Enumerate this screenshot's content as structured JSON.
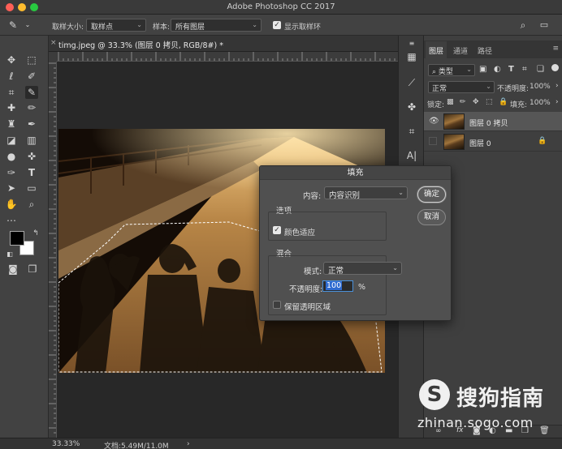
{
  "app": {
    "title": "Adobe Photoshop CC 2017"
  },
  "options": {
    "sample_size_label": "取样大小:",
    "sample_size_value": "取样点",
    "sample_label": "样本:",
    "sample_value": "所有图层",
    "show_ring_label": "显示取样环",
    "show_ring_checked": true
  },
  "document": {
    "tab_label": "timg.jpeg @ 33.3% (图层 0 拷贝, RGB/8#) *",
    "zoom": "33.33%",
    "doc_info": "文档:5.49M/11.0M"
  },
  "panel": {
    "tabs": [
      "图层",
      "通道",
      "路径"
    ],
    "filter_value": "类型",
    "blend_mode": "正常",
    "opacity_label": "不透明度:",
    "opacity_value": "100%",
    "lock_label": "锁定:",
    "fill_label": "填充:",
    "fill_value": "100%",
    "layers": [
      {
        "name": "图层 0 拷贝",
        "visible": true,
        "selected": true,
        "locked": false
      },
      {
        "name": "图层 0",
        "visible": false,
        "selected": false,
        "locked": true
      }
    ]
  },
  "dialog": {
    "title": "填充",
    "content_label": "内容:",
    "content_value": "内容识别",
    "options_group": "选项",
    "color_adapt_label": "颜色适应",
    "color_adapt_checked": true,
    "blend_group": "混合",
    "mode_label": "模式:",
    "mode_value": "正常",
    "opacity_label": "不透明度:",
    "opacity_value": "100",
    "opacity_unit": "%",
    "preserve_label": "保留透明区域",
    "preserve_checked": false,
    "ok_label": "确定",
    "cancel_label": "取消"
  },
  "watermark": {
    "cn": "搜狗指南",
    "url": "zhinan.sogo.com",
    "logo_letter": "S"
  },
  "colors": {
    "accent_blue": "#2f6bd0",
    "traffic_red": "#ff5f57",
    "traffic_yellow": "#febc2e",
    "traffic_green": "#28c840"
  }
}
